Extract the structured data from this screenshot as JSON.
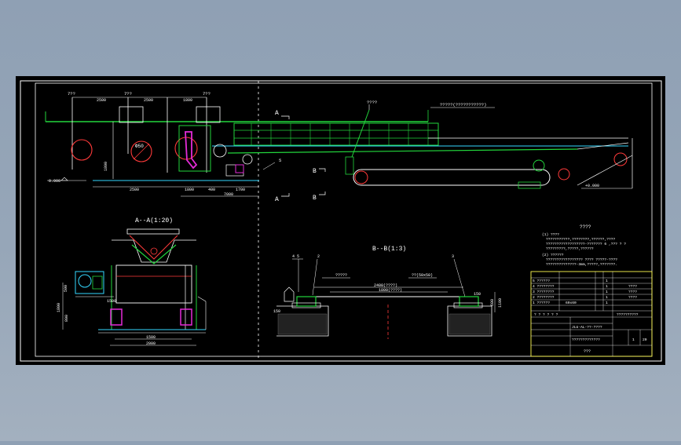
{
  "colors": {
    "background": "#97a7b9",
    "canvas": "#000000",
    "frame": "#ffffff",
    "green": "#22d63c",
    "cyan": "#34d8ff",
    "magenta": "#e52bd8",
    "red": "#ff3a3a",
    "yellow": "#fffb50"
  },
  "section_markers": {
    "a_top": "A",
    "a_bottom": "A",
    "b_top": "B",
    "b_bottom": "B"
  },
  "elevation": {
    "top_labels": [
      "7??",
      "7??",
      "7??"
    ],
    "dim_top": [
      "2500",
      "2500",
      "1800"
    ],
    "dim_bottom": [
      "2500",
      "1800",
      "400",
      "1700"
    ],
    "dim_total": "7000",
    "left_height": "1800",
    "left_level": "0.000",
    "callout_1": "????",
    "callout_2": "?????(???????????)",
    "callout_3": "5",
    "right_level": "+0.000"
  },
  "section_a": {
    "title": "A--A(1:20)",
    "dims": [
      "1500",
      "1800",
      "2000",
      "500",
      "800"
    ]
  },
  "section_b": {
    "title": "B--B(1:3)",
    "callouts": [
      "4 5",
      "2",
      "3"
    ],
    "labels": [
      "?????",
      "??(50x50)",
      "2400(????)",
      "1800(????)"
    ],
    "dims": [
      "150",
      "150",
      "600",
      "1100"
    ]
  },
  "notes": {
    "title": "????",
    "lines": [
      "(1) ????",
      "???????????,????????,??????,????",
      "??????????????????-??????? 6 ,??? ? ?",
      "?????????,?????,??????",
      "(2) ??????",
      "????????????????? ???? ?????-????",
      "??????????????-3mm,?????,???????."
    ]
  },
  "title_block": {
    "parts": [
      "5 ??????",
      "4 ????????",
      "3 ????????",
      "2 ????????",
      "1 ??????"
    ],
    "qty": [
      "1",
      "1",
      "1",
      "1",
      "1"
    ],
    "spec_right": [
      "????",
      "????",
      "????"
    ],
    "part_note": "60x60",
    "header_code": "? ?  ? ?  ? ?",
    "company": "??????????",
    "drawing_no": "JLU-AL-??-????",
    "name": "?????????????",
    "sheet": "1",
    "scale": "20",
    "footer": "???"
  }
}
